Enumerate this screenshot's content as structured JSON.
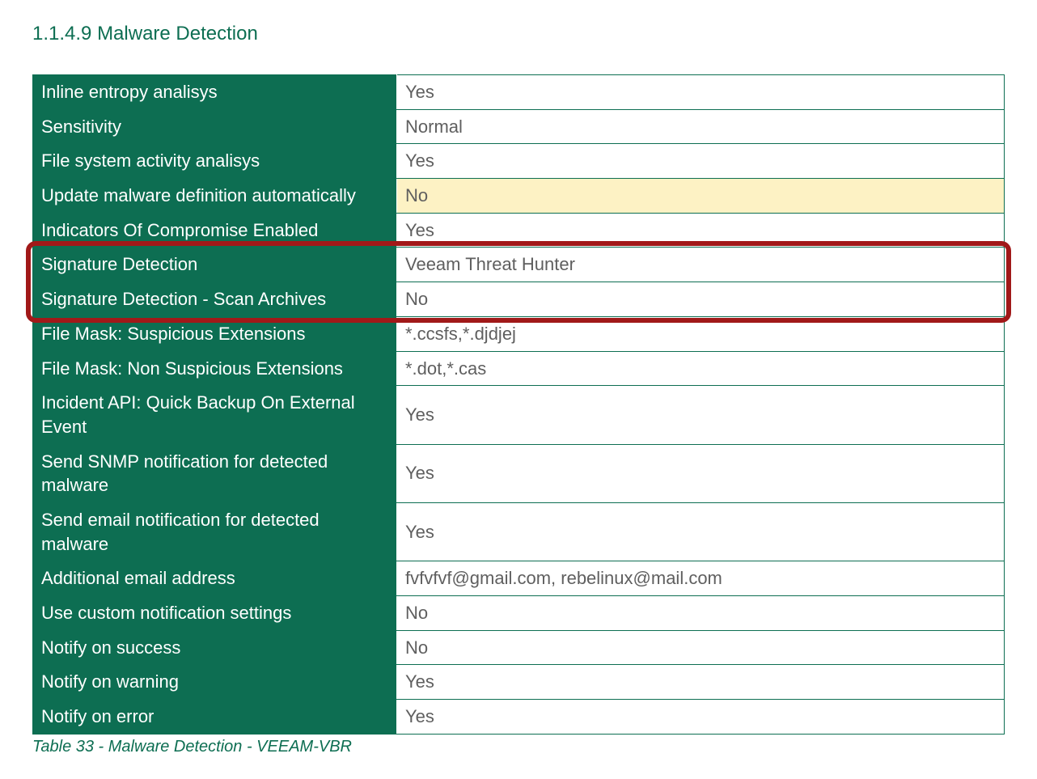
{
  "heading": "1.1.4.9 Malware Detection",
  "caption": "Table 33 - Malware Detection - VEEAM-VBR",
  "rows": [
    {
      "key": "Inline entropy analisys",
      "value": "Yes",
      "warn": false
    },
    {
      "key": "Sensitivity",
      "value": "Normal",
      "warn": false
    },
    {
      "key": "File system activity analisys",
      "value": "Yes",
      "warn": false
    },
    {
      "key": "Update malware definition automatically",
      "value": "No",
      "warn": true
    },
    {
      "key": "Indicators Of Compromise Enabled",
      "value": "Yes",
      "warn": false
    },
    {
      "key": "Signature Detection",
      "value": "Veeam Threat Hunter",
      "warn": false
    },
    {
      "key": "Signature Detection - Scan Archives",
      "value": "No",
      "warn": false
    },
    {
      "key": "File Mask: Suspicious Extensions",
      "value": "*.ccsfs,*.djdjej",
      "warn": false
    },
    {
      "key": "File Mask: Non Suspicious Extensions",
      "value": "*.dot,*.cas",
      "warn": false
    },
    {
      "key": "Incident API: Quick Backup On External Event",
      "value": "Yes",
      "warn": false
    },
    {
      "key": "Send SNMP notification for detected malware",
      "value": "Yes",
      "warn": false
    },
    {
      "key": "Send email notification for detected malware",
      "value": "Yes",
      "warn": false
    },
    {
      "key": "Additional email address",
      "value": "fvfvfvf@gmail.com, rebelinux@mail.com",
      "warn": false
    },
    {
      "key": "Use custom notification settings",
      "value": "No",
      "warn": false
    },
    {
      "key": "Notify on success",
      "value": "No",
      "warn": false
    },
    {
      "key": "Notify on warning",
      "value": "Yes",
      "warn": false
    },
    {
      "key": "Notify on error",
      "value": "Yes",
      "warn": false
    }
  ],
  "highlight": {
    "startRow": 5,
    "endRow": 6
  }
}
